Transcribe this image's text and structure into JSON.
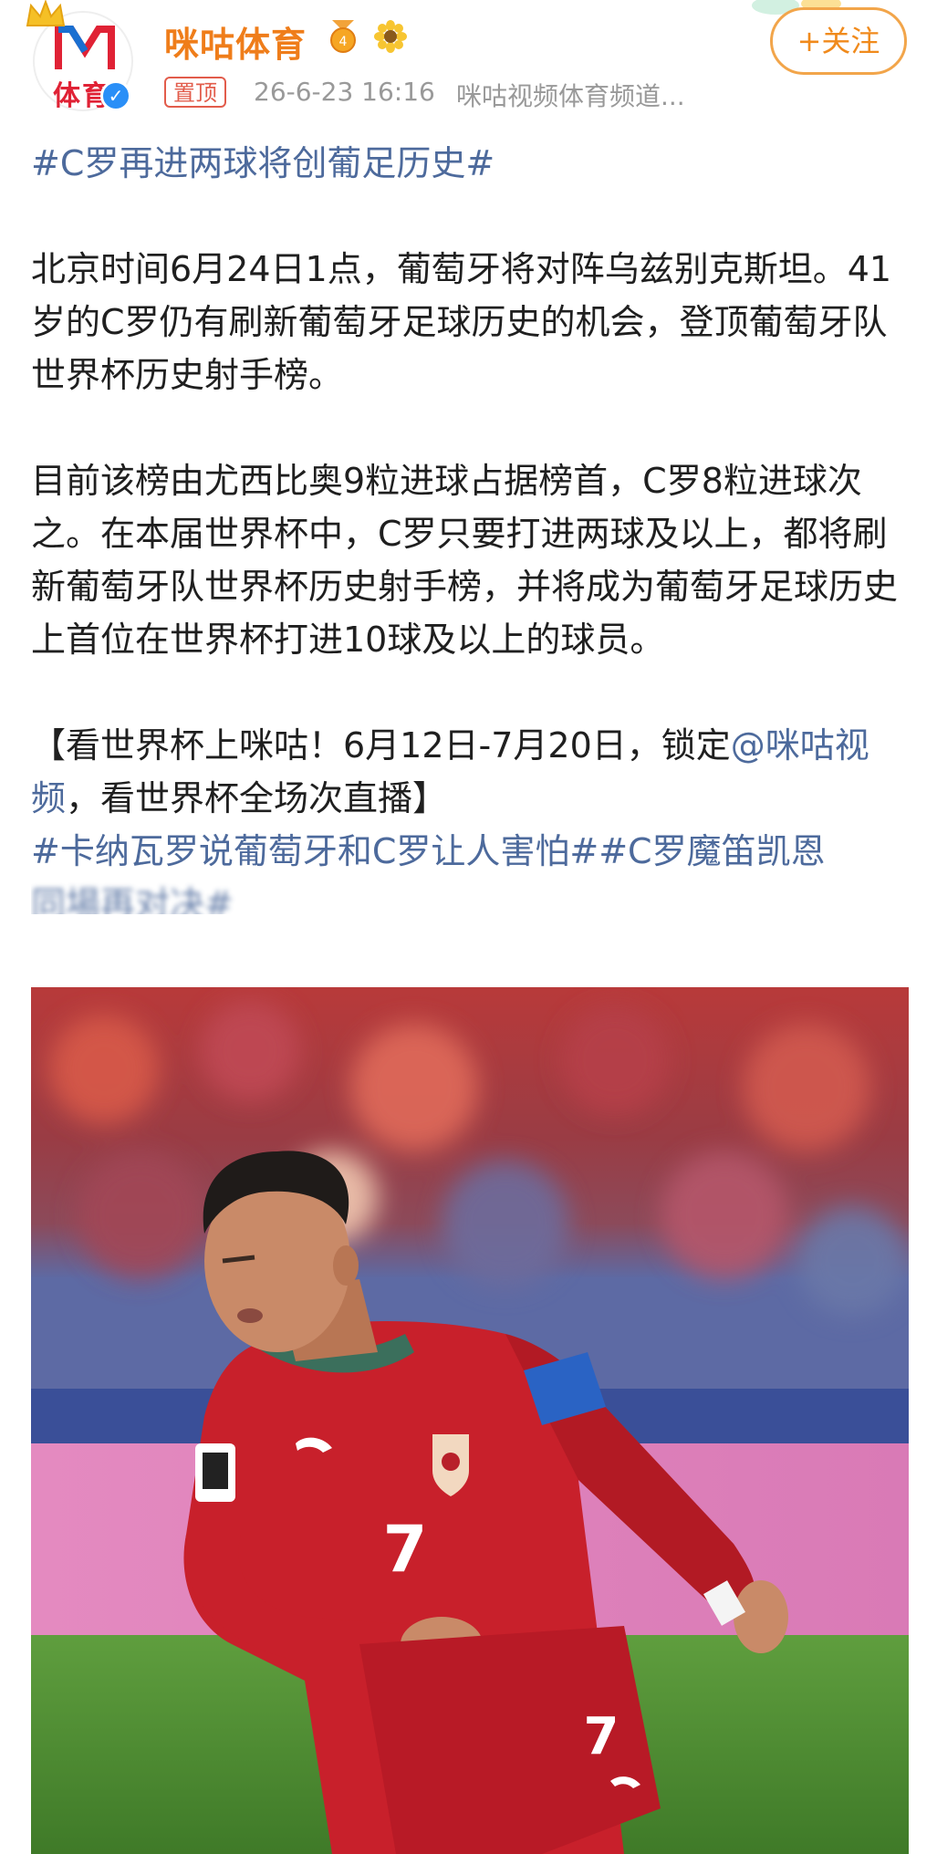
{
  "header": {
    "account_name": "咪咕体育",
    "avatar_logo_text": "体育",
    "pinned_label": "置顶",
    "timestamp": "26-6-23 16:16",
    "source": "咪咕视频体育频道...",
    "follow_label": "+关注",
    "icons": {
      "crown": "crown-icon",
      "verified": "verified-icon",
      "medal": "medal-icon",
      "sunflower": "sunflower-icon"
    }
  },
  "post": {
    "title_hashtag": "#C罗再进两球将创葡足历史#",
    "paragraph1": "北京时间6月24日1点，葡萄牙将对阵乌兹别克斯坦。41岁的C罗仍有刷新葡萄牙足球历史的机会，登顶葡萄牙队世界杯历史射手榜。",
    "paragraph2": "目前该榜由尤西比奥9粒进球占据榜首，C罗8粒进球次之。在本届世界杯中，C罗只要打进两球及以上，都将刷新葡萄牙队世界杯历史射手榜，并将成为葡萄牙足球历史上首位在世界杯打进10球及以上的球员。",
    "promo_prefix": "【看世界杯上咪咕！6月12日-7月20日，锁定",
    "promo_mention": "@咪咕视频",
    "promo_suffix": "，看世界杯全场次直播】",
    "hashtag_line": "#卡纳瓦罗说葡萄牙和C罗让人害怕##C罗魔笛凯恩",
    "hashtag_line_cut": "同場再对决#"
  },
  "photo": {
    "jersey_number": "7",
    "colors": {
      "jersey": "#c8202b",
      "armband": "#2a63c4",
      "pitch": "#5c9c3a",
      "ad_board": "#e07ab8"
    }
  },
  "colors": {
    "accent_orange": "#ef7d1a",
    "link_blue": "#4d6a9c",
    "pinned_red": "#e25c4b"
  }
}
